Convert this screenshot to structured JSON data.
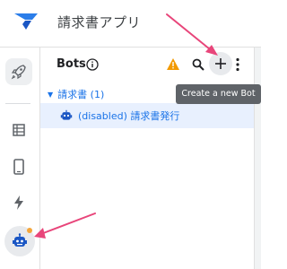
{
  "header": {
    "app_title": "請求書アプリ"
  },
  "nav": {
    "items": [
      {
        "name": "automation",
        "icon": "rocket-icon"
      },
      {
        "name": "data",
        "icon": "table-icon"
      },
      {
        "name": "app",
        "icon": "phone-icon"
      },
      {
        "name": "actions",
        "icon": "bolt-icon"
      },
      {
        "name": "bots",
        "icon": "robot-icon",
        "selected": true,
        "badge_color": "#f4a63a"
      }
    ]
  },
  "panel": {
    "title": "Bots",
    "group": {
      "label": "請求書 (1)"
    },
    "bot": {
      "label": "(disabled) 請求書発行"
    },
    "add_tooltip": "Create a new Bot"
  },
  "colors": {
    "accent": "#1a73e8",
    "warning": "#f29900",
    "annotation_arrow": "#e8457a",
    "selected_row": "#e8f0fe"
  }
}
